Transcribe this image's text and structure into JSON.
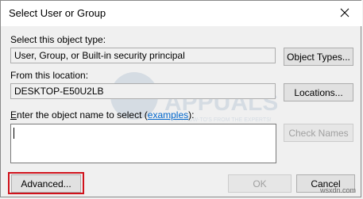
{
  "window": {
    "title": "Select User or Group",
    "close_label": "Close"
  },
  "object_type": {
    "label": "Select this object type:",
    "value": "User, Group, or Built-in security principal",
    "button": "Object Types..."
  },
  "location": {
    "label": "From this location:",
    "value": "DESKTOP-E50U2LB",
    "button": "Locations..."
  },
  "names": {
    "label_prefix_underlined": "E",
    "label_middle": "nter the object name to select (",
    "examples_link": "examples",
    "label_suffix": "):",
    "value": "",
    "check_button": "Check Names"
  },
  "footer": {
    "advanced_button": "Advanced...",
    "ok_button": "OK",
    "cancel_button": "Cancel"
  },
  "watermark": {
    "brand": "APPUALS",
    "tagline": "TECH HOW-TO'S FROM THE EXPERTS!"
  },
  "credit": "wsxdn.com"
}
